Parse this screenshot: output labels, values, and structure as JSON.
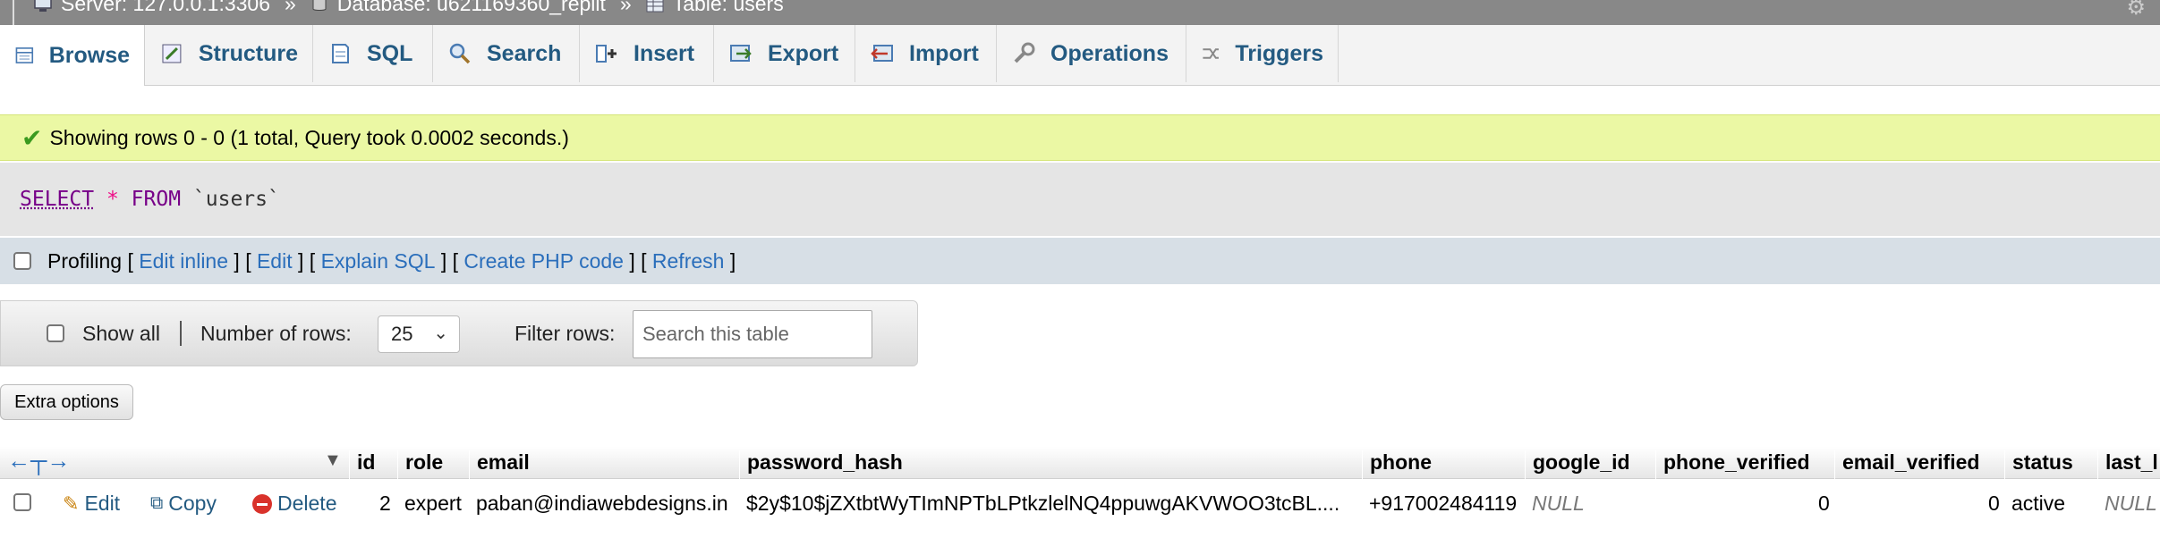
{
  "breadcrumb": {
    "server": "Server: 127.0.0.1:3306",
    "database": "Database: u621169360_replit",
    "table": "Table: users",
    "separator": "»"
  },
  "tabs": [
    {
      "label": "Browse",
      "icon": "browse-icon"
    },
    {
      "label": "Structure",
      "icon": "structure-icon"
    },
    {
      "label": "SQL",
      "icon": "sql-icon"
    },
    {
      "label": "Search",
      "icon": "search-icon"
    },
    {
      "label": "Insert",
      "icon": "insert-icon"
    },
    {
      "label": "Export",
      "icon": "export-icon"
    },
    {
      "label": "Import",
      "icon": "import-icon"
    },
    {
      "label": "Operations",
      "icon": "operations-icon"
    },
    {
      "label": "Triggers",
      "icon": "triggers-icon"
    }
  ],
  "message": {
    "text": "Showing rows 0 - 0 (1 total, Query took 0.0002 seconds.)"
  },
  "query": {
    "select": "SELECT",
    "star": "*",
    "from": "FROM",
    "table": "`users`"
  },
  "profiling": {
    "label": "Profiling",
    "edit_inline": "Edit inline",
    "edit": "Edit",
    "explain_sql": "Explain SQL",
    "create_php": "Create PHP code",
    "refresh": "Refresh",
    "open_bracket": "[",
    "close_bracket": "]"
  },
  "navigation": {
    "show_all": "Show all",
    "number_of_rows_label": "Number of rows:",
    "number_of_rows_value": "25",
    "filter_rows_label": "Filter rows:",
    "filter_placeholder": "Search this table"
  },
  "extra_options": "Extra options",
  "table": {
    "columns": [
      "id",
      "role",
      "email",
      "password_hash",
      "phone",
      "google_id",
      "phone_verified",
      "email_verified",
      "status",
      "last_l"
    ],
    "row": {
      "edit": "Edit",
      "copy": "Copy",
      "delete": "Delete",
      "id": "2",
      "role": "expert",
      "email": "paban@indiawebdesigns.in",
      "password_hash": "$2y$10$jZXtbtWyTImNPTbLPtkzlelNQ4ppuwgAKVWOO3tcBL....",
      "phone": "+917002484119",
      "google_id": "NULL",
      "phone_verified": "0",
      "email_verified": "0",
      "status": "active",
      "last_l": "NULL"
    }
  },
  "colors": {
    "accent": "#235a81",
    "success_bg": "#ebf8a4",
    "link": "#2a6ebb"
  }
}
